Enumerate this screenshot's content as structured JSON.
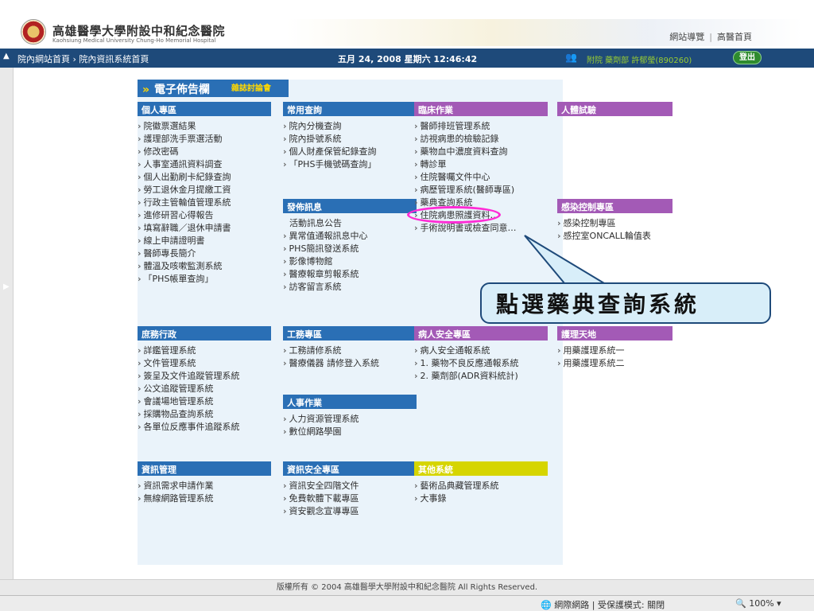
{
  "header": {
    "hospital_name": "高雄醫學大學附設中和紀念醫院",
    "hospital_eng": "Kaohsiung Medical University Chung-Ho Memorial Hospital",
    "links": [
      "網站導覽",
      "高醫首頁"
    ]
  },
  "navbar": {
    "breadcrumb": "院內網站首頁 › 院內資訊系統首頁",
    "datetime": "五月 24, 2008  星期六   12:46:42",
    "userinfo": "附院  藥劑部  許郁瑩(890260)",
    "logout": "登出"
  },
  "board": {
    "title": "電子佈告欄",
    "arrows": "»",
    "subtitle": "雜誌討論會"
  },
  "sections": {
    "personal": {
      "title": "個人專區",
      "items": [
        "院徽票選結果",
        "護理部洗手票選活動",
        "修改密碼",
        "人事室通訊資料調查",
        "個人出勤刷卡紀錄查詢",
        "勞工退休金月提繳工資",
        "行政主管輪值管理系統",
        "進修研習心得報告",
        "填寫辭職／退休申請書",
        "線上申請證明書",
        "醫師專長簡介",
        "體溫及咳嗽監測系統",
        "「PHS帳單查詢」"
      ]
    },
    "common": {
      "title": "常用查詢",
      "items": [
        "院內分機查詢",
        "院內掛號系統",
        "個人財產保管紀錄查詢",
        "「PHS手機號碼查詢」"
      ]
    },
    "publish": {
      "title": "發佈訊息",
      "items": [
        "活動訊息公告",
        "異常值通報訊息中心",
        "PHS簡訊發送系統",
        "影像博物館",
        "醫療報章剪報系統",
        "訪客留言系統"
      ]
    },
    "clinical": {
      "title": "臨床作業",
      "items": [
        "醫師排班管理系統",
        "訪視病患的檢驗記錄",
        "藥物血中濃度資料查詢",
        "轉診單",
        "住院醫囑文件中心",
        "病歷管理系統(醫師專區)",
        "藥典查詢系統",
        "住院病患照護資料…",
        "手術說明書或檢查同意…"
      ]
    },
    "human_trial": {
      "title": "人體試驗",
      "items": []
    },
    "infection": {
      "title": "感染控制專區",
      "items": [
        "感染控制專區",
        "感控室ONCALL輪值表"
      ]
    },
    "general_admin": {
      "title": "庶務行政",
      "items": [
        "詳鑑管理系統",
        "文件管理系統",
        "簽呈及文件追蹤管理系統",
        "公文追蹤管理系統",
        "會議場地管理系統",
        "採購物品查詢系統",
        "各單位反應事件追蹤系統"
      ]
    },
    "engineering": {
      "title": "工務專區",
      "items": [
        "工務請修系統",
        "醫療儀器 請修登入系統"
      ]
    },
    "hr": {
      "title": "人事作業",
      "items": [
        "人力資源管理系統",
        "數位網路學園"
      ]
    },
    "patient_safety": {
      "title": "病人安全專區",
      "items": [
        "病人安全通報系統",
        "1. 藥物不良反應通報系統",
        "2. 藥劑部(ADR資料統計)"
      ]
    },
    "nursing": {
      "title": "護理天地",
      "items": [
        "用藥護理系統一",
        "用藥護理系統二"
      ]
    },
    "it_mgmt": {
      "title": "資訊管理",
      "items": [
        "資訊需求申請作業",
        "無線網路管理系統"
      ]
    },
    "it_security": {
      "title": "資訊安全專區",
      "items": [
        "資訊安全四階文件",
        "免費軟體下載專區",
        "資安觀念宣導專區"
      ]
    },
    "other": {
      "title": "其他系統",
      "items": [
        "藝術品典藏管理系統",
        "大事錄"
      ]
    }
  },
  "annotation": {
    "callout": "點選藥典查詢系統"
  },
  "footer": {
    "copyright": "版權所有 © 2004 高雄醫學大學附設中和紀念醫院 All Rights Reserved."
  },
  "statusbar": {
    "zone": "網際網路 | 受保護模式: 關閉",
    "zoom": "100%"
  }
}
